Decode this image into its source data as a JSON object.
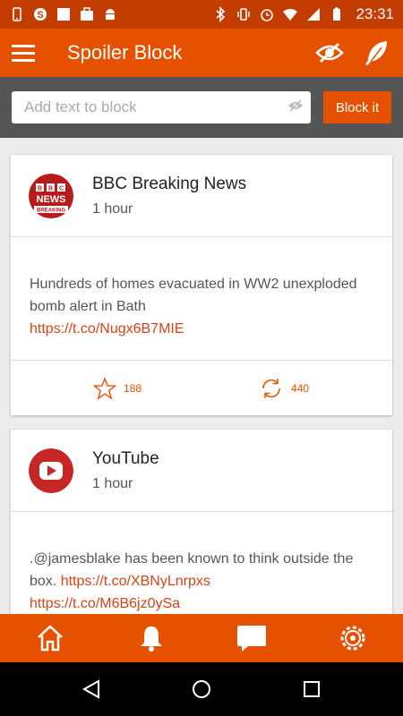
{
  "status_bar": {
    "time": "23:31",
    "icons": [
      "phone-icon",
      "skype-icon",
      "square-icon",
      "briefcase-icon",
      "android-icon",
      "bluetooth-icon",
      "vibrate-icon",
      "alarm-icon",
      "wifi-icon",
      "signal-icon",
      "battery-icon"
    ]
  },
  "app_bar": {
    "title": "Spoiler Block",
    "icons": [
      "menu-icon",
      "eye-off-icon",
      "feather-icon"
    ]
  },
  "block_bar": {
    "placeholder": "Add text to block",
    "value": "",
    "button_label": "Block it"
  },
  "feed": {
    "posts": [
      {
        "author": "BBC Breaking News",
        "avatar": "BBC NEWS BREAKING",
        "time": "1 hour",
        "text": "Hundreds of homes evacuated in WW2 unexploded bomb alert in Bath",
        "links": [
          "https://t.co/Nugx6B7MIE"
        ],
        "likes": "188",
        "retweets": "440"
      },
      {
        "author": "YouTube",
        "avatar": "youtube-logo",
        "time": "1 hour",
        "text": ".@jamesblake has been known to think outside the box.",
        "links": [
          "https://t.co/XBNyLnrpxs",
          "https://t.co/M6B6jz0ySa"
        ]
      }
    ]
  },
  "bottom_nav": {
    "items": [
      "home-icon",
      "bell-icon",
      "chat-icon",
      "settings-icon"
    ]
  },
  "system_nav": {
    "items": [
      "back-icon",
      "home-circle-icon",
      "recents-icon"
    ]
  },
  "colors": {
    "status_bar": "#c43d00",
    "app_bar": "#e65100",
    "block_bar": "#555555",
    "link": "#d84315"
  }
}
